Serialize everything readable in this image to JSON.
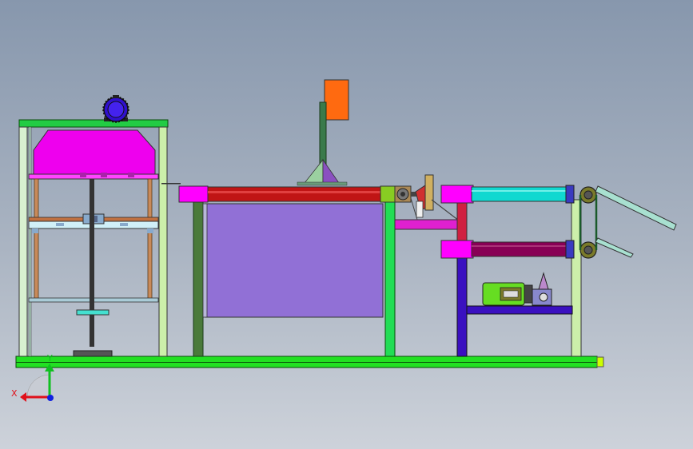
{
  "viewport": {
    "background_top": "#8797ad",
    "background_bottom": "#cdd2da"
  },
  "triad": {
    "x_label": "X",
    "y_label": "Y",
    "x_color": "#e0101a",
    "y_color": "#10c020",
    "z_color": "#1020e0"
  },
  "colors": {
    "base_rail": "#22e022",
    "frame_green": "#22cc44",
    "light_frame": "#ccefaa",
    "pale_post": "#d8f0d0",
    "magenta": "#ff00ff",
    "hood": "#ee00ee",
    "motor_blue": "#3010cc",
    "rod_copper": "#c88a5a",
    "shaft": "#333333",
    "tank": "#9170d6",
    "belt_red": "#c01515",
    "orange_block": "#ff6a10",
    "cyan_roller": "#10d8d0",
    "maroon_roller": "#880055",
    "purple_post": "#3a10c0",
    "dark_olive": "#4a7a3a",
    "gear_motor": "#66dd22"
  }
}
